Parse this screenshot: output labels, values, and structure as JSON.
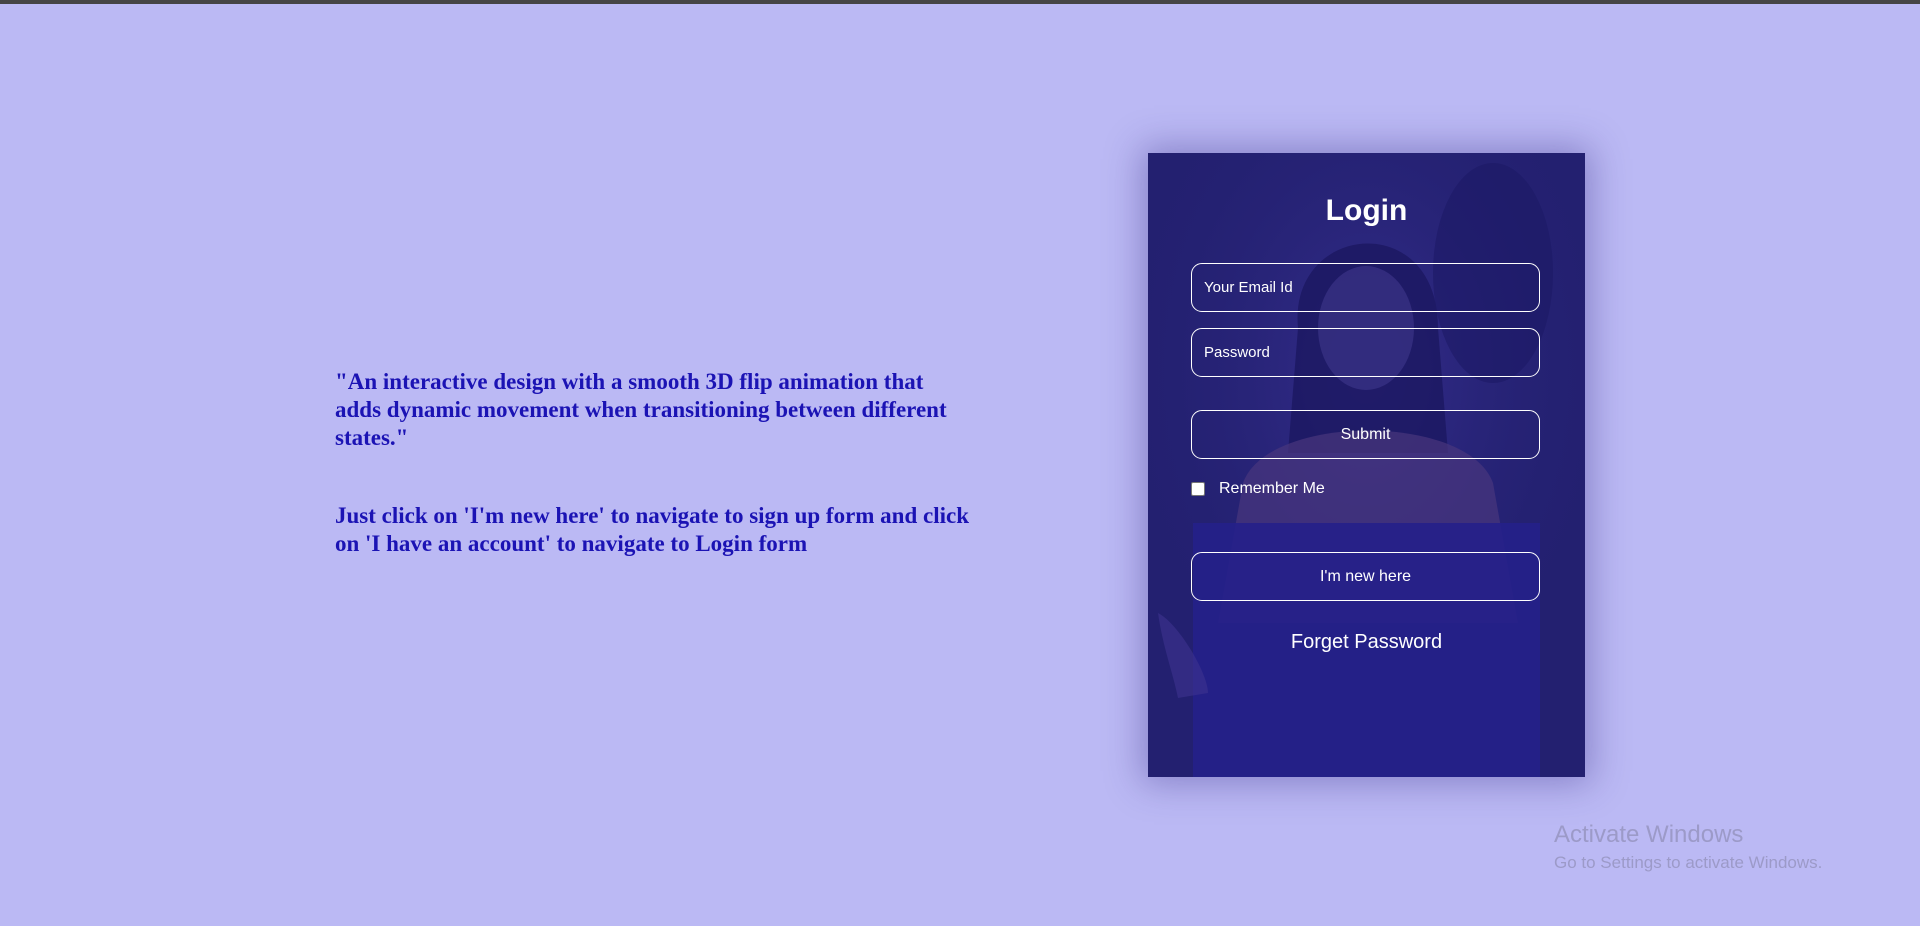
{
  "intro": {
    "quote": "\"An interactive design with a smooth 3D flip animation that adds dynamic movement when transitioning between different states.\"",
    "instructions": "Just click on 'I'm new here' to navigate to sign up form and click on 'I have an account' to navigate to Login form"
  },
  "login": {
    "title": "Login",
    "email_placeholder": "Your Email Id",
    "email_value": "",
    "password_placeholder": "Password",
    "password_value": "",
    "submit_label": "Submit",
    "remember_label": "Remember Me",
    "remember_checked": false,
    "new_here_label": "I'm new here",
    "forget_label": "Forget Password"
  },
  "watermark": {
    "title": "Activate Windows",
    "subtitle": "Go to Settings to activate Windows."
  },
  "colors": {
    "background": "#bbb9f4",
    "accent_text": "#1b13b4",
    "card": "#232070",
    "card_text": "#ffffff"
  }
}
